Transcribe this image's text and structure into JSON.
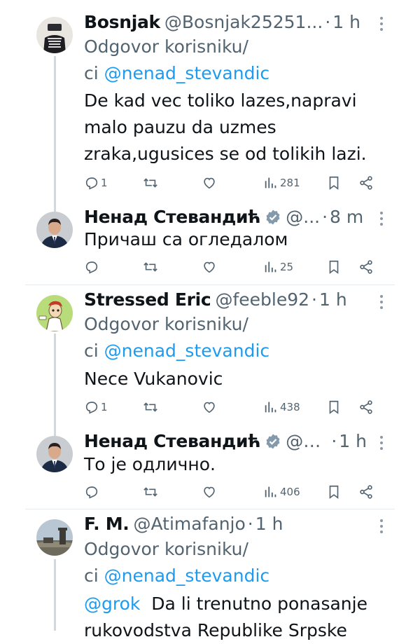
{
  "tweets": [
    {
      "name": "Bosnjak",
      "handle": "@Bosnjak25251...",
      "time": "1 h",
      "reply_prefix": "Odgovor korisniku/",
      "reply_ci": "ci",
      "reply_handle": "@nenad_stevandic",
      "text_lines": [
        "De kad vec toliko lazes,napravi",
        "malo pauzu da uzmes",
        "zraka,ugusices se od tolikih lazi."
      ],
      "replies": "1",
      "views": "281"
    },
    {
      "name": "Ненад Стевандић",
      "handle": "@...",
      "time": "8 m",
      "text_lines": [
        "Причаш са огледалом"
      ],
      "views": "25"
    },
    {
      "name": "Stressed Eric",
      "handle": "@feeble92",
      "time": "1 h",
      "reply_prefix": "Odgovor korisniku/",
      "reply_ci": "ci",
      "reply_handle": "@nenad_stevandic",
      "text_lines": [
        "Nece Vukanovic"
      ],
      "replies": "1",
      "views": "438"
    },
    {
      "name": "Ненад Стевандић",
      "handle": "@n...",
      "time": "1 h",
      "text_lines": [
        "То је одлично."
      ],
      "views": "406"
    },
    {
      "name": "F. M.",
      "handle": "@Atimafanjo",
      "time": "1 h",
      "reply_prefix": "Odgovor korisniku/",
      "reply_ci": "ci",
      "reply_handle": "@nenad_stevandic",
      "text_mention": "@grok",
      "text_lines": [
        "Da li trenutno ponasanje",
        "rukovodstva Republike Srpske"
      ]
    }
  ],
  "icons": {
    "reply": "reply-icon",
    "retweet": "retweet-icon",
    "like": "heart-icon",
    "views": "views-icon",
    "bookmark": "bookmark-icon",
    "share": "share-icon",
    "verified": "verified-badge-icon",
    "more": "more-options-icon"
  },
  "colors": {
    "link": "#1d9bf0",
    "secondary_text": "#536471",
    "thread_line": "#cfd9de",
    "verified_badge": "#829aab"
  }
}
